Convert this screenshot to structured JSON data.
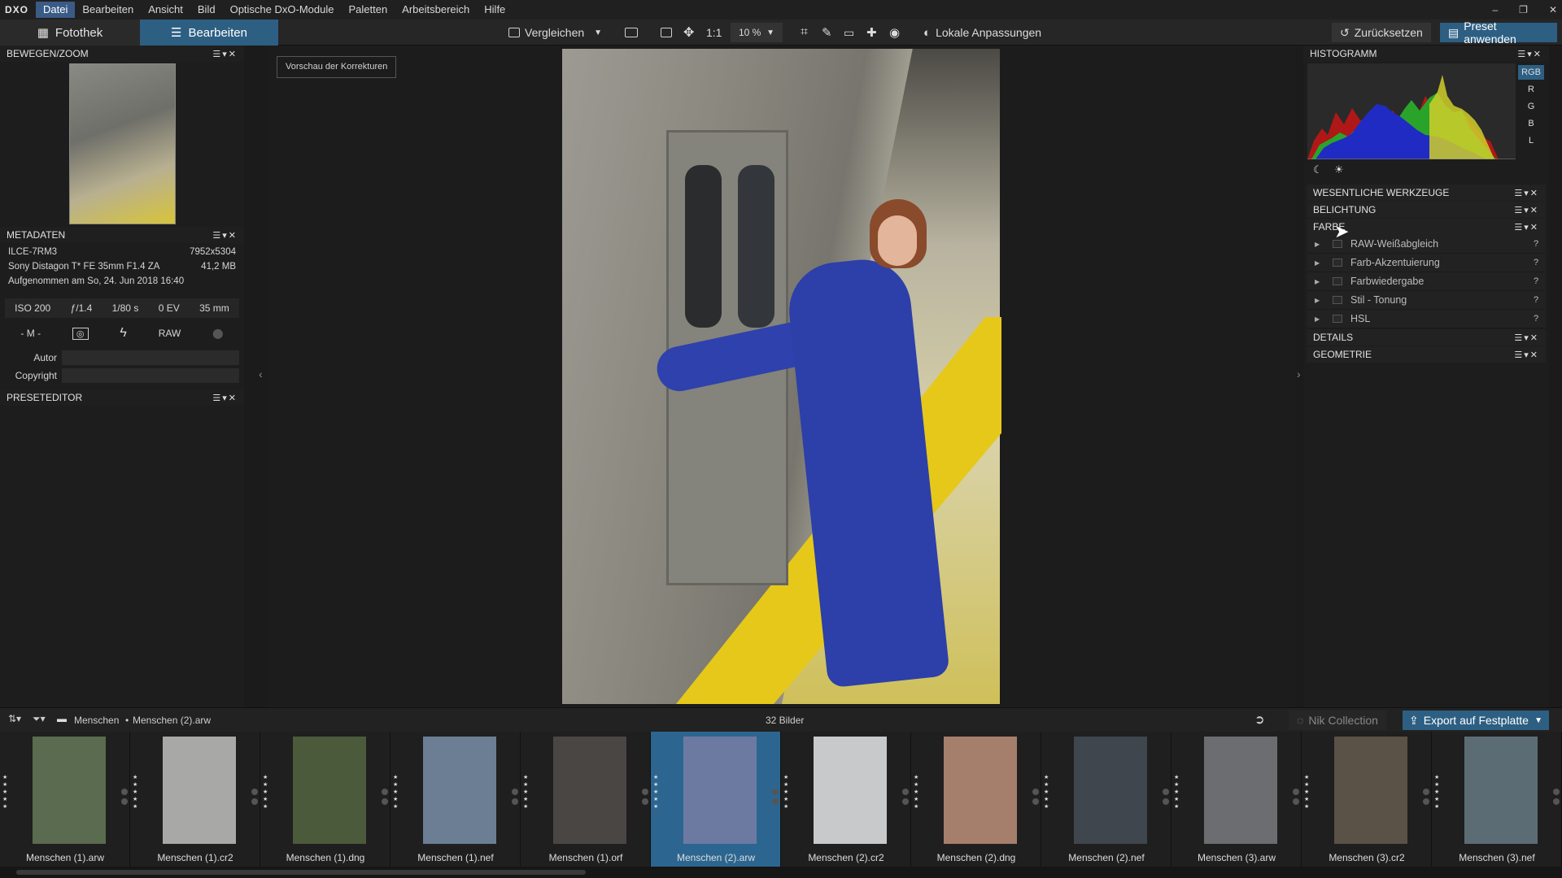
{
  "app": {
    "logo": "DXO"
  },
  "menu": [
    "Datei",
    "Bearbeiten",
    "Ansicht",
    "Bild",
    "Optische DxO-Module",
    "Paletten",
    "Arbeitsbereich",
    "Hilfe"
  ],
  "window": {
    "minimize": "–",
    "restore": "❐",
    "close": "✕"
  },
  "modes": {
    "library": "Fotothek",
    "edit": "Bearbeiten"
  },
  "toolbar": {
    "compare": "Vergleichen",
    "one_to_one": "1:1",
    "zoom": "10 %",
    "local_adjust": "Lokale Anpassungen",
    "reset": "Zurücksetzen",
    "apply_preset": "Preset anwenden"
  },
  "left": {
    "move_zoom_title": "BEWEGEN/ZOOM",
    "metadata_title": "METADATEN",
    "camera": "ILCE-7RM3",
    "resolution": "7952x5304",
    "lens": "Sony Distagon T* FE 35mm F1.4 ZA",
    "filesize": "41,2 MB",
    "date": "Aufgenommen am So, 24. Jun 2018 16:40",
    "exif": [
      "ISO 200",
      "ƒ/1.4",
      "1/80 s",
      "0 EV",
      "35 mm"
    ],
    "mode": "- M -",
    "raw": "RAW",
    "author_label": "Autor",
    "copyright_label": "Copyright",
    "preset_editor_title": "PRESETEDITOR"
  },
  "center": {
    "preview_button": "Vorschau der Korrekturen"
  },
  "right": {
    "histogram_title": "HISTOGRAMM",
    "channels": [
      "RGB",
      "R",
      "G",
      "B",
      "L"
    ],
    "sections": {
      "essential": "WESENTLICHE WERKZEUGE",
      "exposure": "BELICHTUNG",
      "color": "FARBE",
      "details": "DETAILS",
      "geometry": "GEOMETRIE"
    },
    "color_tools": [
      "RAW-Weißabgleich",
      "Farb-Akzentuierung",
      "Farbwiedergabe",
      "Stil - Tonung",
      "HSL"
    ],
    "help": "?"
  },
  "filmbar": {
    "folder": "Menschen",
    "file": "Menschen (2).arw",
    "count": "32 Bilder",
    "nik": "Nik Collection",
    "export": "Export auf Festplatte"
  },
  "films": [
    {
      "name": "Menschen (1).arw",
      "color": "#5a6b4f"
    },
    {
      "name": "Menschen (1).cr2",
      "color": "#a8a9a6"
    },
    {
      "name": "Menschen (1).dng",
      "color": "#4c5a3c"
    },
    {
      "name": "Menschen (1).nef",
      "color": "#6c7e94"
    },
    {
      "name": "Menschen (1).orf",
      "color": "#4a4643"
    },
    {
      "name": "Menschen (2).arw",
      "color": "#6c7aa2"
    },
    {
      "name": "Menschen (2).cr2",
      "color": "#c7c9cb"
    },
    {
      "name": "Menschen (2).dng",
      "color": "#a67f6c"
    },
    {
      "name": "Menschen (2).nef",
      "color": "#3f464d"
    },
    {
      "name": "Menschen (3).arw",
      "color": "#6b6d70"
    },
    {
      "name": "Menschen (3).cr2",
      "color": "#5a5147"
    },
    {
      "name": "Menschen (3).nef",
      "color": "#5c6c74"
    }
  ]
}
